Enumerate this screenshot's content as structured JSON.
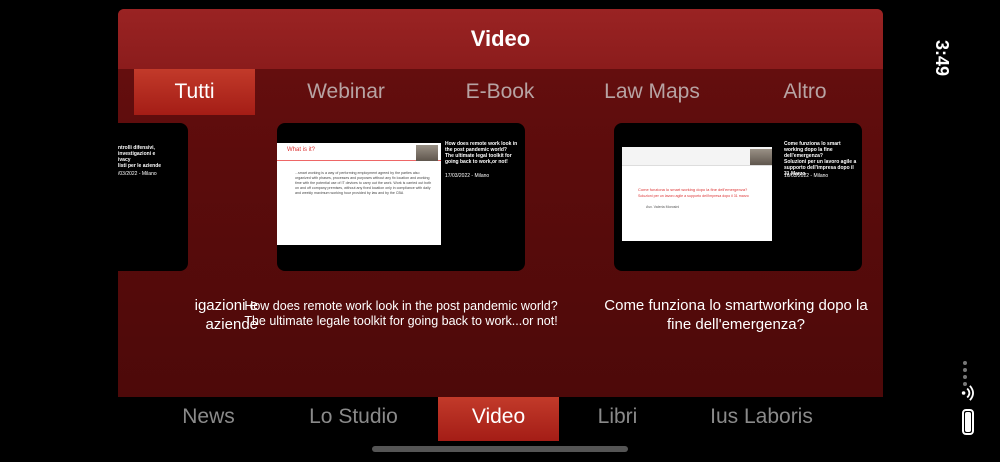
{
  "header": {
    "title": "Video"
  },
  "tabs": [
    {
      "label": "Tutti",
      "active": true
    },
    {
      "label": "Webinar",
      "active": false
    },
    {
      "label": "E-Book",
      "active": false
    },
    {
      "label": "Law Maps",
      "active": false
    },
    {
      "label": "Altro",
      "active": false
    }
  ],
  "videos": [
    {
      "caption": "igazioni e\naziende",
      "thumb_meta": "ntrolli difensivi, investigazioni e\nivacy\nlisti per le aziende",
      "thumb_date": "/03/2022 - Milano"
    },
    {
      "caption": "How does remote work look in the post pandemic world?\nThe ultimate legale toolkit for going back to work...or not!",
      "slide_title": "What is it?",
      "slide_text": "...smart working is a way of performing employment agreed by the parties also organized with phases, processes and purposes without any fix location and working time with the potential use of IT devices to carry out the work. Work is carried out both on and off company premises, without any fixed location only in compliance with daily and weekly maximum working hour provided by law and by the CBA",
      "thumb_meta": "How does remote work look in the post pandemic world?\nThe ultimate legal toolkit for going back to work,or not!",
      "thumb_date": "17/03/2022 - Milano"
    },
    {
      "caption": "Come funziona lo smartworking dopo la\nfine dell'emergenza?",
      "slide_title": "Come funziona lo smart working dopo la fine dell'emergenza?",
      "slide_subtitle": "Soluzioni per un lavoro agile a supporto dell'impresa dopo il 31 marzo",
      "slide_author": "Avv. Valeria Morosini",
      "thumb_meta": "Come funziona lo smart working dopo la fine dell'emergenza?\nSoluzioni per un lavoro agile a supporto dell'impresa dopo il 31 Marzo",
      "thumb_date": "16/03/2022 - Milano"
    }
  ],
  "bottom_nav": [
    {
      "label": "News",
      "active": false
    },
    {
      "label": "Lo Studio",
      "active": false
    },
    {
      "label": "Video",
      "active": true
    },
    {
      "label": "Libri",
      "active": false
    },
    {
      "label": "Ius Laboris",
      "active": false
    }
  ],
  "status": {
    "time": "3:49",
    "icons": [
      "signal-dots-icon",
      "wifi-icon",
      "battery-icon"
    ]
  },
  "colors": {
    "brand_red": "#8b1c1c",
    "active_tab": "#b5291f",
    "background": "#000000"
  }
}
